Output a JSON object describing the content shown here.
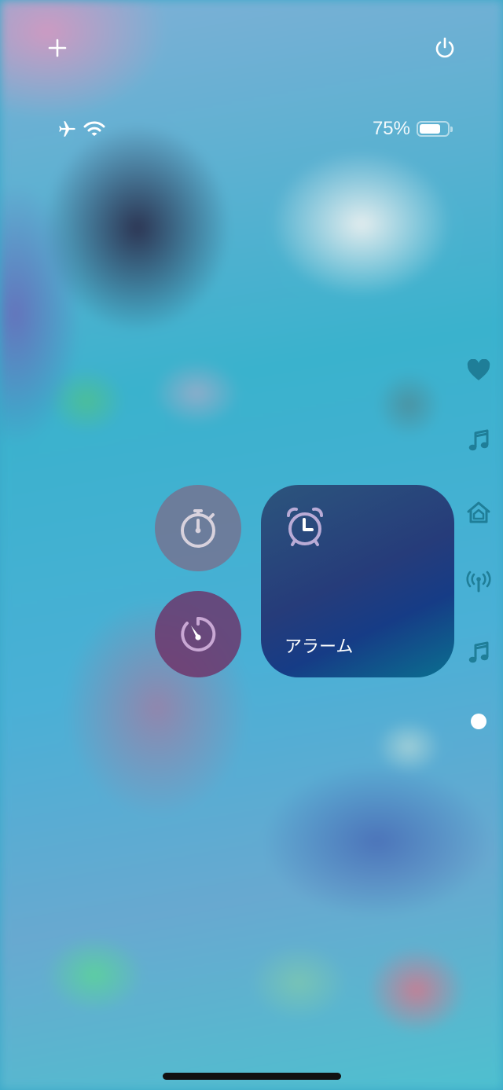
{
  "status_bar": {
    "battery_percent_text": "75%",
    "battery_level": 0.75,
    "left_icons": [
      "airplane-icon",
      "wifi-icon"
    ]
  },
  "top_controls": {
    "left_icon": "plus-icon",
    "right_icon": "power-icon"
  },
  "controls": {
    "stopwatch": {
      "icon": "stopwatch-icon"
    },
    "timer": {
      "icon": "timer-icon"
    },
    "alarm": {
      "icon": "alarm-clock-icon",
      "label": "アラーム"
    }
  },
  "side_pages": [
    "heart-icon",
    "music-note-icon",
    "home-icon",
    "antenna-icon",
    "music-note-icon",
    "current-page-dot"
  ],
  "colors": {
    "stopwatch_bg": "#7d6987",
    "timer_bg": "#6e2d64",
    "alarm_tile_top": "#2c557d",
    "alarm_tile_bottom": "#0a7090",
    "side_icon": "#1f7e98",
    "alarm_icon": "#b9abd6"
  }
}
